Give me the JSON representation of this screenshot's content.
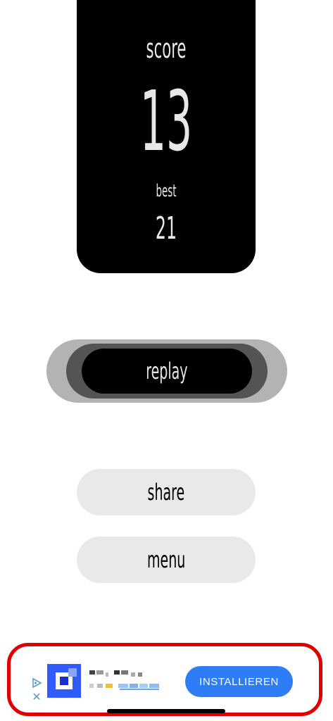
{
  "score_card": {
    "score_label": "score",
    "score_value": "13",
    "best_label": "best",
    "best_value": "21"
  },
  "buttons": {
    "replay_label": "replay",
    "share_label": "share",
    "menu_label": "menu"
  },
  "ad": {
    "install_label": "INSTALLIEREN",
    "close_symbol": "✕",
    "choices_icon": "ad-choices-icon",
    "app_icon": "app-icon"
  },
  "colors": {
    "card_background": "#000000",
    "replay_outer": "#b3b3b3",
    "replay_mid": "#545454",
    "pill_background": "#e9e9e9",
    "ad_border": "#e00000",
    "install_button": "#2f7df6"
  }
}
